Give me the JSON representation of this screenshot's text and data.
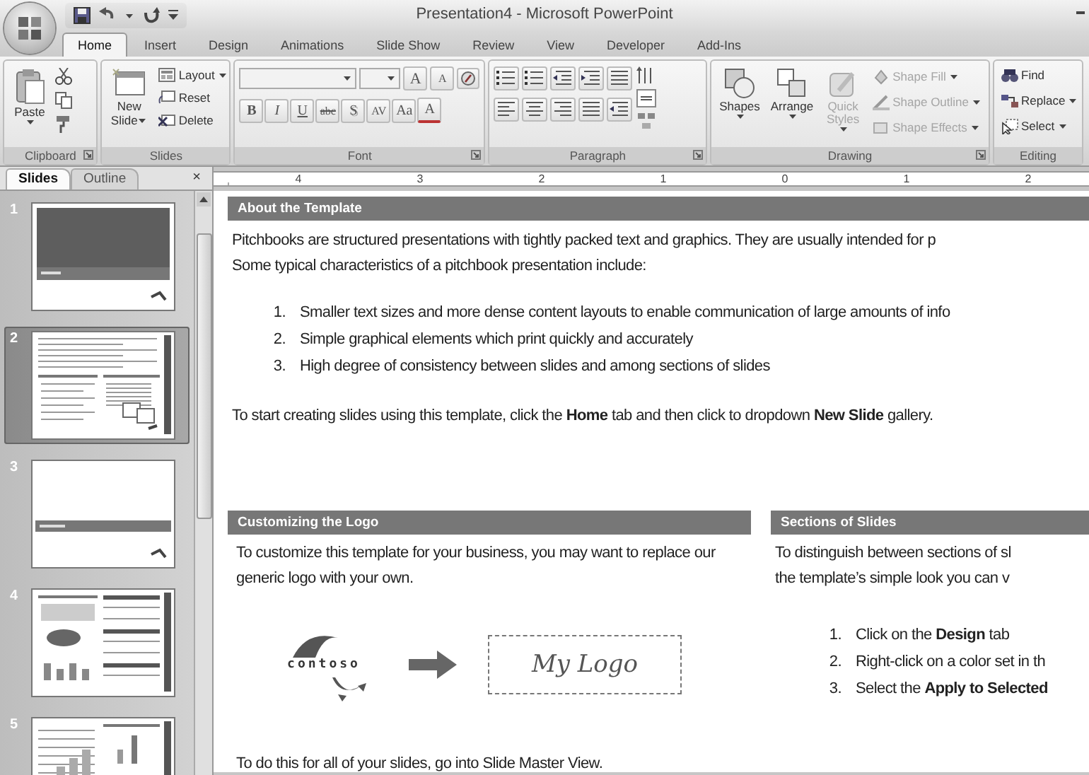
{
  "window": {
    "title": "Presentation4 - Microsoft PowerPoint"
  },
  "ribbon_tabs": [
    {
      "label": "Home",
      "selected": true
    },
    {
      "label": "Insert",
      "selected": false
    },
    {
      "label": "Design",
      "selected": false
    },
    {
      "label": "Animations",
      "selected": false
    },
    {
      "label": "Slide Show",
      "selected": false
    },
    {
      "label": "Review",
      "selected": false
    },
    {
      "label": "View",
      "selected": false
    },
    {
      "label": "Developer",
      "selected": false
    },
    {
      "label": "Add-Ins",
      "selected": false
    }
  ],
  "clipboard": {
    "label": "Clipboard",
    "paste": "Paste"
  },
  "slides_group": {
    "label": "Slides",
    "new_slide": [
      "New",
      "Slide"
    ],
    "layout": "Layout",
    "reset": "Reset",
    "delete": "Delete"
  },
  "font": {
    "label": "Font",
    "grow": "A",
    "shrink": "A",
    "buttons": [
      {
        "text": "B",
        "kind": "bold"
      },
      {
        "text": "I",
        "kind": "italic"
      },
      {
        "text": "U",
        "kind": "underline"
      },
      {
        "text": "abc",
        "kind": "strike"
      },
      {
        "text": "S",
        "kind": "shadow"
      },
      {
        "text": "AV",
        "kind": "spacing"
      },
      {
        "text": "Aa",
        "kind": "case"
      },
      {
        "text": "A",
        "kind": "color"
      }
    ]
  },
  "paragraph": {
    "label": "Paragraph"
  },
  "drawing": {
    "label": "Drawing",
    "large": [
      {
        "label": "Shapes",
        "disabled": false
      },
      {
        "label": "Arrange",
        "disabled": false
      },
      {
        "label": "Quick Styles",
        "disabled": true
      }
    ],
    "small": [
      {
        "label": "Shape Fill",
        "disabled": true
      },
      {
        "label": "Shape Outline",
        "disabled": true
      },
      {
        "label": "Shape Effects",
        "disabled": true
      }
    ]
  },
  "editing": {
    "label": "Editing",
    "items": [
      {
        "label": "Find",
        "kind": "find"
      },
      {
        "label": "Replace",
        "kind": "replace"
      },
      {
        "label": "Select",
        "kind": "select"
      }
    ]
  },
  "slides_pane": {
    "tabs": [
      {
        "label": "Slides",
        "selected": true
      },
      {
        "label": "Outline",
        "selected": false
      }
    ],
    "close": "×",
    "slides": [
      {
        "number": "1",
        "kind": "title",
        "selected": false
      },
      {
        "number": "2",
        "kind": "text",
        "selected": true
      },
      {
        "number": "3",
        "kind": "section",
        "selected": false
      },
      {
        "number": "4",
        "kind": "table",
        "selected": false
      },
      {
        "number": "5",
        "kind": "chart",
        "selected": false
      }
    ]
  },
  "ruler": {
    "labels": [
      "4",
      "3",
      "2",
      "1",
      "0",
      "1",
      "2"
    ]
  },
  "slide": {
    "about": {
      "heading": "About the Template",
      "intro": [
        "Pitchbooks are structured presentations with tightly packed text and graphics. They are usually intended for p",
        "Some typical characteristics of a pitchbook presentation include:"
      ],
      "list": [
        {
          "number": "1.",
          "text": "Smaller text sizes and more dense content layouts to enable communication of large amounts of info"
        },
        {
          "number": "2.",
          "text": "Simple graphical elements which print quickly and accurately"
        },
        {
          "number": "3.",
          "text": "High degree of consistency between slides and among sections of slides"
        }
      ],
      "closing": "To start creating slides using this template, click the **Home** tab and then click to dropdown **New Slide** gallery."
    },
    "logo_section": {
      "heading": "Customizing the Logo",
      "text": "To customize this template for your business, you may want to replace our generic logo with your own.",
      "logo_text": "contoso",
      "placeholder": "My Logo",
      "footer": "To do this for all of your slides, go into Slide Master View."
    },
    "sections_section": {
      "heading": "Sections of Slides",
      "text": [
        "To distinguish between sections of sl",
        "the template’s simple look you can v"
      ],
      "list": [
        {
          "number": "1.",
          "text": "Click on the **Design** tab"
        },
        {
          "number": "2.",
          "text": "Right-click on a color set in th"
        },
        {
          "number": "3.",
          "text": "Select the **Apply to Selected**"
        }
      ]
    }
  }
}
